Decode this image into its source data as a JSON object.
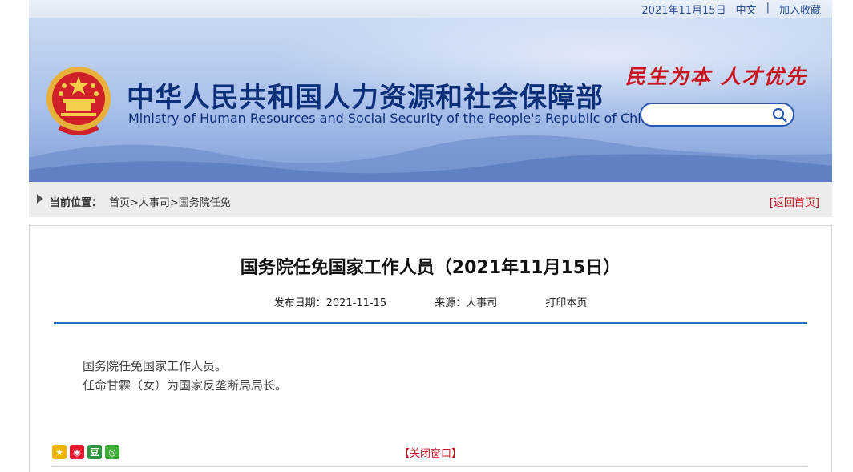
{
  "topbar": {
    "date": "2021年11月15日",
    "lang": "中文",
    "separator": "|",
    "bookmark": "加入收藏"
  },
  "banner": {
    "title_cn": "中华人民共和国人力资源和社会保障部",
    "title_en": "Ministry of Human Resources and Social Security of the People's Republic of China",
    "slogan": "民生为本 人才优先",
    "search_placeholder": ""
  },
  "breadcrumb": {
    "label": "当前位置：",
    "path": "首页>人事司>国务院任免",
    "back_home": "[返回首页]"
  },
  "article": {
    "title": "国务院任免国家工作人员（2021年11月15日）",
    "publish_date": "发布日期：2021-11-15",
    "source": "来源：人事司",
    "print": "打印本页",
    "body_lines": [
      "国务院任免国家工作人员。",
      "任命甘霖（女）为国家反垄断局局长。"
    ],
    "close": "【关闭窗口】"
  },
  "colors": {
    "brand_blue": "#0c2f7a",
    "accent_red": "#c8141e",
    "divider_blue": "#2a6cc0"
  }
}
